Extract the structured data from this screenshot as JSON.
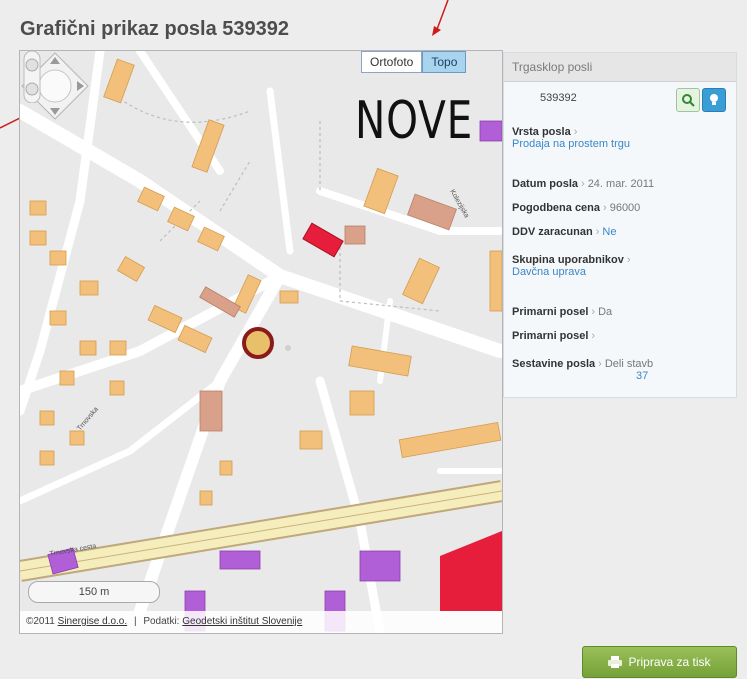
{
  "title": "Grafični prikaz posla 539392",
  "map": {
    "layers": [
      {
        "label": "Ortofoto",
        "active": false
      },
      {
        "label": "Topo",
        "active": true
      }
    ],
    "overlay_text": "NOVE",
    "scale_label": "150 m",
    "copyright": {
      "prefix": "©2011",
      "company": "Sinergise d.o.o.",
      "sep": "|",
      "data_label": "Podatki:",
      "data_source": "Geodetski inštitut Slovenije"
    },
    "street_labels": [
      "Trnovska cesta",
      "Trnovska cesta",
      "Kolezijska ulica"
    ],
    "colors": {
      "highlight_fill": "#e8c06a",
      "highlight_ring": "#8b1a1a",
      "new_building": "#e61e3c",
      "purple": "#b05fd6"
    }
  },
  "side": {
    "header": "Trgasklop posli",
    "job_id": "539392",
    "fields": [
      {
        "label": "Vrsta posla",
        "value": "Prodaja na prostem trgu",
        "type": "link-below"
      },
      {
        "label": "Datum posla",
        "value": "24. mar. 2011",
        "type": "inline"
      },
      {
        "label": "Pogodbena cena",
        "value": "96000",
        "type": "inline"
      },
      {
        "label": "DDV zaracunan",
        "value": "Ne",
        "type": "inline-link"
      },
      {
        "label": "Skupina uporabnikov",
        "value": "Davčna uprava",
        "type": "link-below"
      },
      {
        "label": "Primarni posel",
        "value": "Da",
        "type": "inline"
      },
      {
        "label": "Primarni posel",
        "value": "",
        "type": "inline"
      },
      {
        "label": "Sestavine posla",
        "value": "Deli stavb",
        "extra": "37",
        "type": "inline-extra"
      }
    ]
  },
  "print_button": "Priprava za tisk"
}
